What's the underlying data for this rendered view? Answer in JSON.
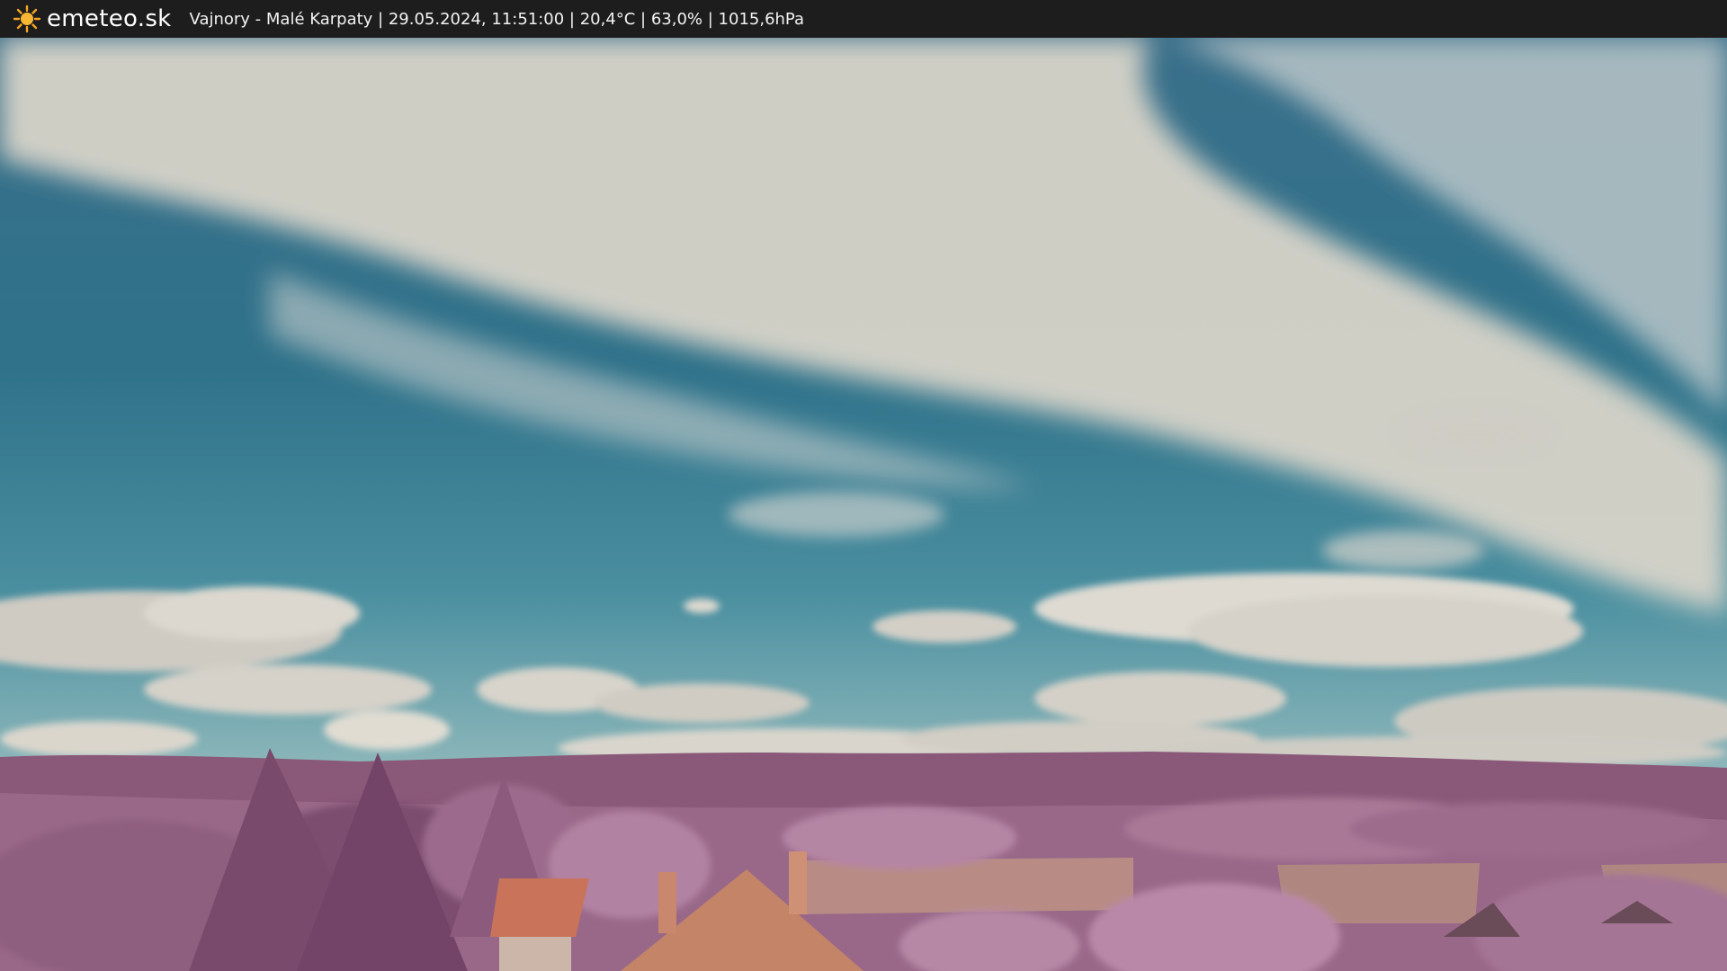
{
  "header": {
    "logo_icon": "sun-icon",
    "brand": "emeteo.sk",
    "location": "Vajnory - Malé Karpaty",
    "timestamp": "29.05.2024, 11:51:00",
    "temperature": "20,4°C",
    "humidity": "63,0%",
    "pressure": "1015,6hPa",
    "caption": "Vajnory - Malé Karpaty | 29.05.2024, 11:51:00 | 20,4°C | 63,0% | 1015,6hPa"
  },
  "colors": {
    "bar": "#1d1d1d",
    "sun": "#f5a623",
    "sky_top": "#2f6c88",
    "sky_low": "#5fa0ad",
    "cloud": "#d9d6cc",
    "hills": "#8e5f7f",
    "foliage": "#b887a6",
    "roof": "#c9735a"
  }
}
